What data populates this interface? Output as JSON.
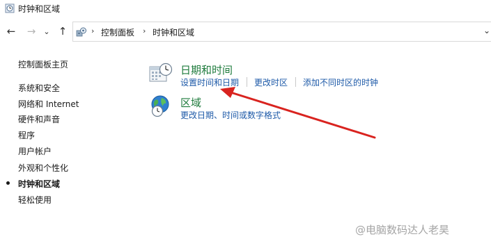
{
  "window": {
    "title": "时钟和区域"
  },
  "nav": {
    "back": "←",
    "forward": "→",
    "recent": "⌄",
    "up": "↑",
    "dropdown": "⌄"
  },
  "breadcrumb": {
    "items": [
      "控制面板",
      "时钟和区域"
    ],
    "separator": "›"
  },
  "sidebar": {
    "home": "控制面板主页",
    "items": [
      {
        "label": "系统和安全"
      },
      {
        "label": "网络和 Internet"
      },
      {
        "label": "硬件和声音"
      },
      {
        "label": "程序"
      },
      {
        "label": "用户帐户"
      },
      {
        "label": "外观和个性化"
      },
      {
        "label": "时钟和区域",
        "active": true
      },
      {
        "label": "轻松使用"
      }
    ]
  },
  "main": {
    "datetime": {
      "title": "日期和时间",
      "links": [
        "设置时间和日期",
        "更改时区",
        "添加不同时区的时钟"
      ]
    },
    "region": {
      "title": "区域",
      "links": [
        "更改日期、时间或数字格式"
      ]
    }
  },
  "colors": {
    "section_title": "#1e7b3c",
    "link": "#1e5aa8",
    "arrow": "#d9231f"
  },
  "watermark": "@电脑数码达人老昊"
}
